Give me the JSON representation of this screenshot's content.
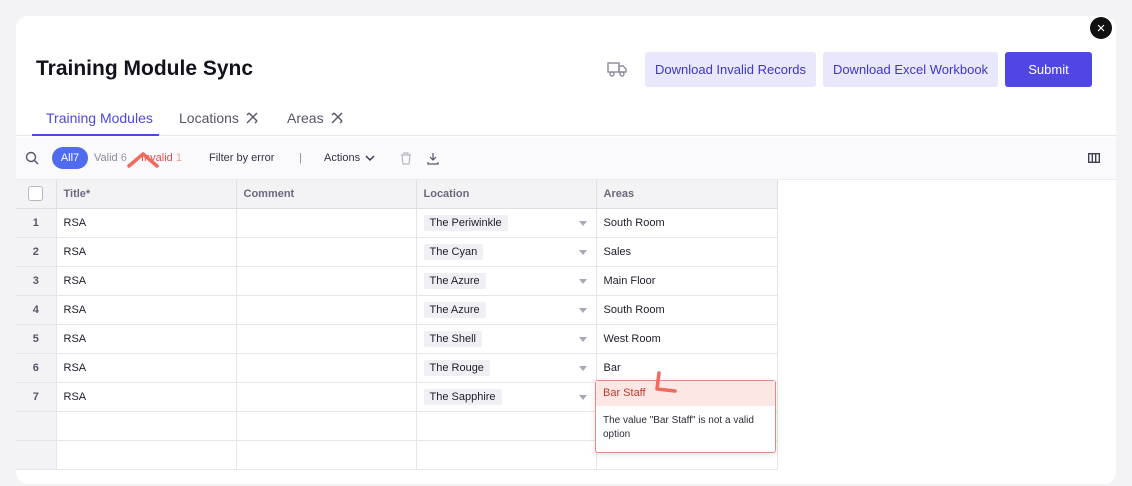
{
  "header": {
    "title": "Training Module Sync",
    "truck_icon": "truck-icon",
    "download_invalid_label": "Download Invalid Records",
    "download_excel_label": "Download Excel Workbook",
    "submit_label": "Submit",
    "close_icon": "close-icon"
  },
  "tabs": [
    {
      "label": "Training Modules",
      "active": true
    },
    {
      "label": "Locations",
      "icon": "tools-icon"
    },
    {
      "label": "Areas",
      "icon": "tools-icon"
    }
  ],
  "toolbar": {
    "all_label": "All",
    "all_count": "7",
    "valid_label": "Valid",
    "valid_count": "6",
    "invalid_label": "Invalid",
    "invalid_count": "1",
    "filter_label": "Filter by error",
    "separator": "|",
    "actions_label": "Actions"
  },
  "grid": {
    "columns": [
      "Title*",
      "Comment",
      "Location",
      "Areas"
    ],
    "rows": [
      {
        "num": "1",
        "title": "RSA",
        "comment": "",
        "location": "The Periwinkle",
        "area": "South Room"
      },
      {
        "num": "2",
        "title": "RSA",
        "comment": "",
        "location": "The Cyan",
        "area": "Sales"
      },
      {
        "num": "3",
        "title": "RSA",
        "comment": "",
        "location": "The Azure",
        "area": "Main Floor"
      },
      {
        "num": "4",
        "title": "RSA",
        "comment": "",
        "location": "The Azure",
        "area": "South Room"
      },
      {
        "num": "5",
        "title": "RSA",
        "comment": "",
        "location": "The Shell",
        "area": "West Room"
      },
      {
        "num": "6",
        "title": "RSA",
        "comment": "",
        "location": "The Rouge",
        "area": "Bar"
      },
      {
        "num": "7",
        "title": "RSA",
        "comment": "",
        "location": "The Sapphire",
        "area": "Bar Staff"
      }
    ]
  },
  "error_popup": {
    "value": "Bar Staff",
    "message": "The value \"Bar Staff\" is not a valid option"
  },
  "colors": {
    "accent": "#4f46e5",
    "error": "#c0392b",
    "annotation": "#f06b5e"
  }
}
